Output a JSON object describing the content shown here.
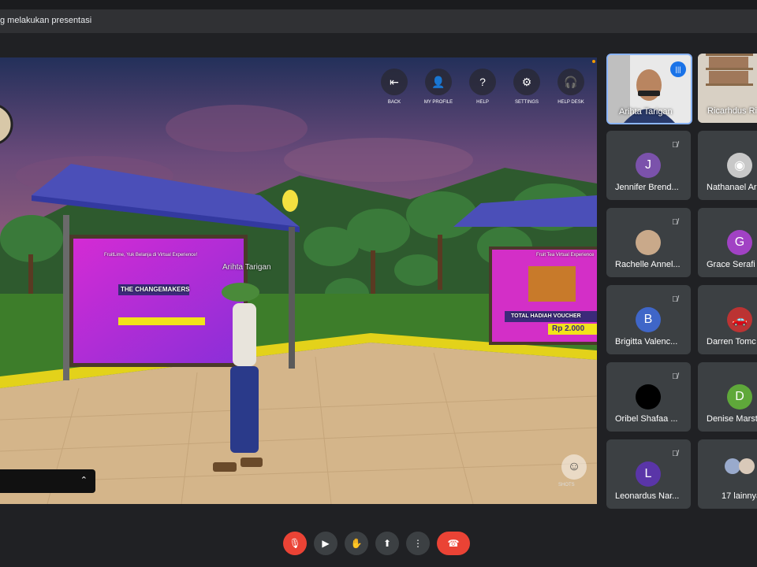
{
  "banner": {
    "text": "g melakukan presentasi"
  },
  "presentation": {
    "hud": [
      {
        "label": "BACK",
        "icon": "back-icon",
        "glyph": "⇤"
      },
      {
        "label": "MY PROFILE",
        "icon": "profile-icon",
        "glyph": "👤"
      },
      {
        "label": "HELP",
        "icon": "help-icon",
        "glyph": "?"
      },
      {
        "label": "SETTINGS",
        "icon": "settings-icon",
        "glyph": "⚙"
      },
      {
        "label": "HELP DESK",
        "icon": "help-desk-icon",
        "glyph": "🎧"
      }
    ],
    "avatar_name": "Arihta Tarigan",
    "billboard_left": {
      "headline": "FruitLime, Yuk Belanja di Virtual Experience!",
      "banner": "THE CHANGEMAKERS"
    },
    "billboard_right": {
      "headline": "Fruit Tea Virtual Experience",
      "prize_label": "TOTAL HADIAH VOUCHER",
      "prize_value": "Rp 2.000"
    },
    "snap_label": "SHOTS"
  },
  "participants": {
    "speaking": {
      "name": "Arihta Tarigan"
    },
    "second": {
      "name": "Ricarhdus Ri"
    },
    "tiles": [
      {
        "name": "Jennifer Brend...",
        "initial": "J",
        "color": "#7b52ab",
        "muted": true
      },
      {
        "name": "Nathanael Ar",
        "initial": "",
        "color": "#c8c8c8",
        "muted": false
      },
      {
        "name": "Rachelle Annel...",
        "initial": "",
        "color": "#c9a98a",
        "muted": true
      },
      {
        "name": "Grace Serafi",
        "initial": "G",
        "color": "#a142c4",
        "muted": false
      },
      {
        "name": "Brigitta Valenc...",
        "initial": "B",
        "color": "#3f66c8",
        "muted": true
      },
      {
        "name": "Darren Tomc",
        "initial": "",
        "color": "#b33",
        "muted": false
      },
      {
        "name": "Oribel Shafaa ...",
        "initial": "",
        "color": "#000000",
        "muted": true
      },
      {
        "name": "Denise Marst",
        "initial": "D",
        "color": "#5fa83a",
        "muted": false
      },
      {
        "name": "Leonardus Nar...",
        "initial": "L",
        "color": "#5a35a8",
        "muted": true
      },
      {
        "name": "17 lainnya",
        "initial": "",
        "color": "#9ac",
        "muted": false
      }
    ]
  },
  "controls": [
    {
      "name": "mic-off-button",
      "icon": "mic-off-icon",
      "glyph": "🎙",
      "style": "red"
    },
    {
      "name": "camera-button",
      "icon": "camera-icon",
      "glyph": "▶",
      "style": ""
    },
    {
      "name": "raise-hand-button",
      "icon": "hand-icon",
      "glyph": "✋",
      "style": ""
    },
    {
      "name": "present-button",
      "icon": "present-icon",
      "glyph": "⬆",
      "style": ""
    },
    {
      "name": "more-options-button",
      "icon": "more-vert-icon",
      "glyph": "⋮",
      "style": ""
    },
    {
      "name": "leave-call-button",
      "icon": "hangup-icon",
      "glyph": "☎",
      "style": "hang"
    }
  ]
}
